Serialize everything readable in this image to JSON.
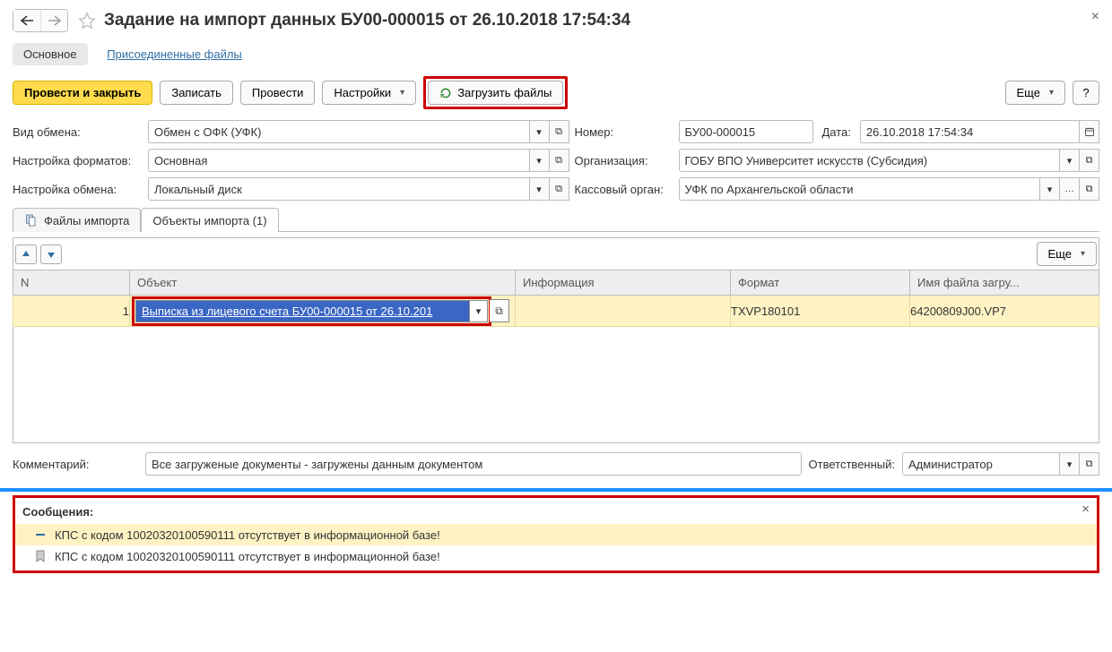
{
  "header": {
    "title": "Задание на импорт данных БУ00-000015 от 26.10.2018 17:54:34"
  },
  "section_tabs": {
    "main": "Основное",
    "attached": "Присоединенные файлы"
  },
  "toolbar": {
    "post_close": "Провести и закрыть",
    "save": "Записать",
    "post": "Провести",
    "settings": "Настройки",
    "load_files": "Загрузить файлы",
    "more": "Еще",
    "help": "?"
  },
  "form": {
    "exchange_type_label": "Вид обмена:",
    "exchange_type": "Обмен с ОФК (УФК)",
    "number_label": "Номер:",
    "number": "БУ00-000015",
    "date_label": "Дата:",
    "date": "26.10.2018 17:54:34",
    "formats_label": "Настройка форматов:",
    "formats": "Основная",
    "org_label": "Организация:",
    "org": "ГОБУ ВПО Университет искусств (Субсидия)",
    "exchange_settings_label": "Настройка обмена:",
    "exchange_settings": "Локальный диск",
    "cash_org_label": "Кассовый орган:",
    "cash_org": "УФК по Архангельской области"
  },
  "tabs": {
    "import_files": "Файлы импорта",
    "import_objects": "Объекты импорта (1)"
  },
  "table_toolbar": {
    "more": "Еще"
  },
  "table": {
    "headers": {
      "n": "N",
      "object": "Объект",
      "info": "Информация",
      "format": "Формат",
      "filename": "Имя файла загру..."
    },
    "rows": [
      {
        "n": "1",
        "object": "Выписка из лицевого счета БУ00-000015 от 26.10.201",
        "info": "",
        "format": "TXVP180101",
        "filename": "64200809J00.VP7"
      }
    ]
  },
  "comment": {
    "label": "Комментарий:",
    "value": "Все загруженые документы - загружены данным документом",
    "resp_label": "Ответственный:",
    "resp_value": "Администратор"
  },
  "messages": {
    "title": "Сообщения:",
    "items": [
      {
        "icon": "minus",
        "text": "КПС с кодом 10020320100590111 отсутствует в информационной базе!"
      },
      {
        "icon": "bookmark",
        "text": "КПС с кодом 10020320100590111 отсутствует в информационной базе!"
      }
    ]
  }
}
